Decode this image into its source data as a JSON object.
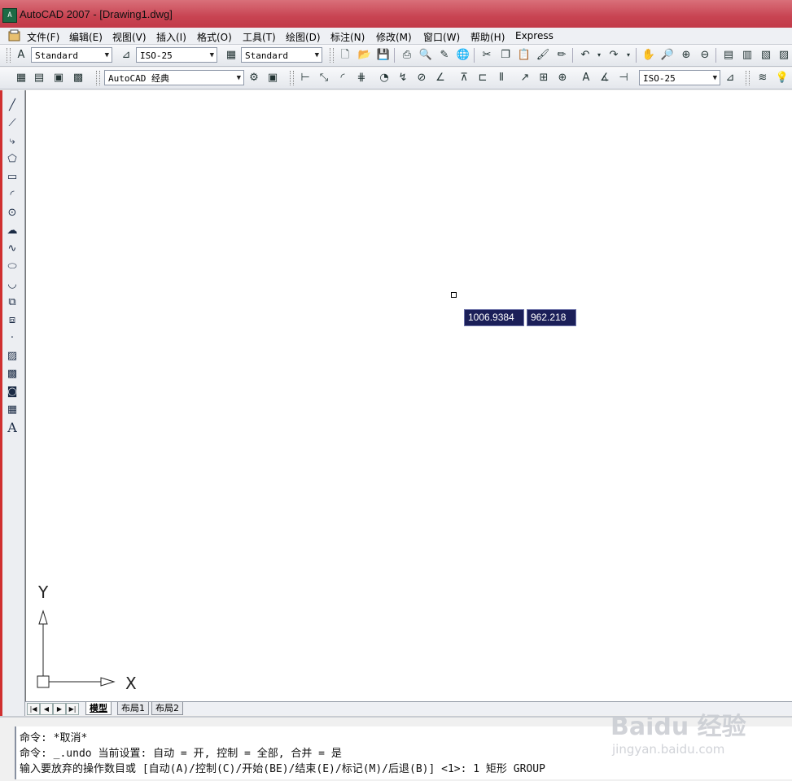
{
  "window": {
    "title": "AutoCAD 2007 - [Drawing1.dwg]",
    "icon": "autocad-app-icon"
  },
  "menu": {
    "items": [
      "文件(F)",
      "编辑(E)",
      "视图(V)",
      "插入(I)",
      "格式(O)",
      "工具(T)",
      "绘图(D)",
      "标注(N)",
      "修改(M)",
      "窗口(W)",
      "帮助(H)",
      "Express"
    ]
  },
  "toolbar1": {
    "text_style": "Standard",
    "dim_style": "ISO-25",
    "table_style": "Standard"
  },
  "toolbar2": {
    "workspace": "AutoCAD 经典",
    "dim_style2": "ISO-25"
  },
  "canvas": {
    "dynamic_input": {
      "x": "1006.9384",
      "y": "962.218"
    },
    "ucs": {
      "y_label": "Y",
      "x_label": "X"
    }
  },
  "layout_tabs": [
    "模型",
    "布局1",
    "布局2"
  ],
  "command": {
    "lines": [
      "命令: *取消*",
      "命令: _.undo 当前设置: 自动 = 开, 控制 = 全部, 合并 = 是",
      "输入要放弃的操作数目或 [自动(A)/控制(C)/开始(BE)/结束(E)/标记(M)/后退(B)] <1>: 1 矩形 GROUP"
    ]
  },
  "watermark": {
    "brand": "Baidu 经验",
    "url": "jingyan.baidu.com"
  }
}
